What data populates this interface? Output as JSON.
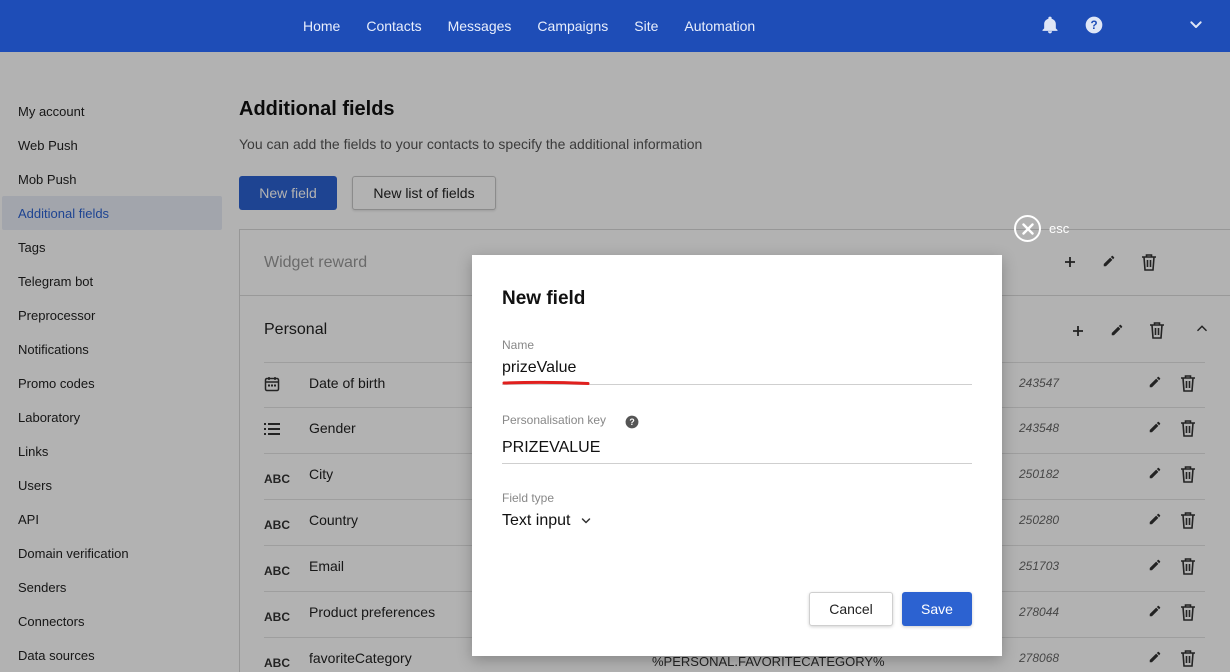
{
  "topnav": {
    "items": [
      "Home",
      "Contacts",
      "Messages",
      "Campaigns",
      "Site",
      "Automation"
    ],
    "icons": [
      "bell-icon",
      "help-icon",
      "chevron-down-icon"
    ]
  },
  "sidebar": {
    "items": [
      {
        "label": "My account"
      },
      {
        "label": "Web Push"
      },
      {
        "label": "Mob Push"
      },
      {
        "label": "Additional fields",
        "active": true
      },
      {
        "label": "Tags"
      },
      {
        "label": "Telegram bot"
      },
      {
        "label": "Preprocessor"
      },
      {
        "label": "Notifications"
      },
      {
        "label": "Promo codes"
      },
      {
        "label": "Laboratory"
      },
      {
        "label": "Links"
      },
      {
        "label": "Users"
      },
      {
        "label": "API"
      },
      {
        "label": "Domain verification"
      },
      {
        "label": "Senders"
      },
      {
        "label": "Connectors"
      },
      {
        "label": "Data sources"
      }
    ]
  },
  "main": {
    "title": "Additional fields",
    "subtitle": "You can add the fields to your contacts to specify the additional information",
    "new_field_label": "New field",
    "new_list_label": "New list of fields",
    "groups": [
      {
        "name": "Widget reward"
      },
      {
        "name": "Personal"
      }
    ],
    "fields": [
      {
        "type_icon": "calendar-icon",
        "name": "Date of birth",
        "key": "",
        "id": "243547"
      },
      {
        "type_icon": "list-icon",
        "name": "Gender",
        "key": "",
        "id": "243548"
      },
      {
        "type_label": "ABC",
        "name": "City",
        "key": "",
        "id": "250182"
      },
      {
        "type_label": "ABC",
        "name": "Country",
        "key": "",
        "id": "250280"
      },
      {
        "type_label": "ABC",
        "name": "Email",
        "key": "",
        "id": "251703"
      },
      {
        "type_label": "ABC",
        "name": "Product preferences",
        "key": "",
        "id": "278044"
      },
      {
        "type_label": "ABC",
        "name": "favoriteCategory",
        "key": "%PERSONAL.FAVORITECATEGORY%",
        "id": "278068"
      }
    ]
  },
  "modal": {
    "esc_label": "esc",
    "title": "New field",
    "name_label": "Name",
    "name_value": "prizeValue",
    "key_label": "Personalisation key",
    "key_value": "PRIZEVALUE",
    "type_label": "Field type",
    "type_value": "Text input",
    "cancel_label": "Cancel",
    "save_label": "Save"
  },
  "colors": {
    "topbar": "#1e4db7",
    "primary": "#2c62d1",
    "highlight_underline": "#e0201e"
  }
}
